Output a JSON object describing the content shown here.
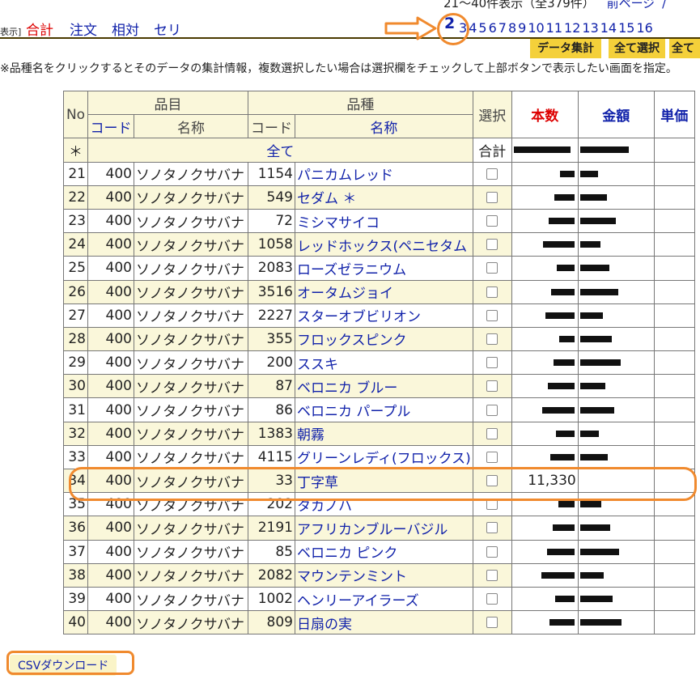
{
  "top": {
    "range_text": "21～40件表示（全379件）",
    "prev_page": "前ページ",
    "edge_glyph": "/"
  },
  "modes": {
    "label": "表示]",
    "items": [
      "合計",
      "注文",
      "相対",
      "セリ"
    ],
    "active_color": "#dd0000",
    "link_color": "#1122aa"
  },
  "pager": {
    "current": "2",
    "pages": [
      "3",
      "4",
      "5",
      "6",
      "7",
      "8",
      "9",
      "10",
      "11",
      "12",
      "13",
      "14",
      "15",
      "16"
    ]
  },
  "buttons": {
    "aggregate": "データ集計",
    "select_all": "全て選択",
    "select_all_2": "全て"
  },
  "instruction": "※品種名をクリックするとそのデータの集計情報，複数選択したい場合は選択欄をチェックして上部ボタンで表示したい画面を指定。",
  "table": {
    "headers": {
      "no": "No",
      "item": "品目",
      "variety": "品種",
      "select": "選択",
      "qty": "本数",
      "amount": "金額",
      "unit": "単価",
      "code": "コード",
      "name": "名称",
      "total_label": "合計",
      "star": "＊",
      "all": "全て"
    },
    "rows": [
      {
        "no": "21",
        "icode": "400",
        "iname": "ソノタノクサバナ",
        "vcode": "1154",
        "vname": "パニカムレッド"
      },
      {
        "no": "22",
        "icode": "400",
        "iname": "ソノタノクサバナ",
        "vcode": "549",
        "vname": "セダム ＊"
      },
      {
        "no": "23",
        "icode": "400",
        "iname": "ソノタノクサバナ",
        "vcode": "72",
        "vname": "ミシマサイコ"
      },
      {
        "no": "24",
        "icode": "400",
        "iname": "ソノタノクサバナ",
        "vcode": "1058",
        "vname": "レッドホックス(ペニセタム"
      },
      {
        "no": "25",
        "icode": "400",
        "iname": "ソノタノクサバナ",
        "vcode": "2083",
        "vname": "ローズゼラニウム"
      },
      {
        "no": "26",
        "icode": "400",
        "iname": "ソノタノクサバナ",
        "vcode": "3516",
        "vname": "オータムジョイ"
      },
      {
        "no": "27",
        "icode": "400",
        "iname": "ソノタノクサバナ",
        "vcode": "2227",
        "vname": "スターオブビリオン"
      },
      {
        "no": "28",
        "icode": "400",
        "iname": "ソノタノクサバナ",
        "vcode": "355",
        "vname": "フロックスピンク"
      },
      {
        "no": "29",
        "icode": "400",
        "iname": "ソノタノクサバナ",
        "vcode": "200",
        "vname": "ススキ"
      },
      {
        "no": "30",
        "icode": "400",
        "iname": "ソノタノクサバナ",
        "vcode": "87",
        "vname": "ベロニカ ブルー"
      },
      {
        "no": "31",
        "icode": "400",
        "iname": "ソノタノクサバナ",
        "vcode": "86",
        "vname": "ベロニカ パープル"
      },
      {
        "no": "32",
        "icode": "400",
        "iname": "ソノタノクサバナ",
        "vcode": "1383",
        "vname": "朝霧"
      },
      {
        "no": "33",
        "icode": "400",
        "iname": "ソノタノクサバナ",
        "vcode": "4115",
        "vname": "グリーンレディ(フロックス)"
      },
      {
        "no": "34",
        "icode": "400",
        "iname": "ソノタノクサバナ",
        "vcode": "33",
        "vname": "丁字草",
        "qty": "11,330"
      },
      {
        "no": "35",
        "icode": "400",
        "iname": "ソノタノクサバナ",
        "vcode": "202",
        "vname": "タカノハ"
      },
      {
        "no": "36",
        "icode": "400",
        "iname": "ソノタノクサバナ",
        "vcode": "2191",
        "vname": "アフリカンブルーバジル"
      },
      {
        "no": "37",
        "icode": "400",
        "iname": "ソノタノクサバナ",
        "vcode": "85",
        "vname": "ベロニカ ピンク"
      },
      {
        "no": "38",
        "icode": "400",
        "iname": "ソノタノクサバナ",
        "vcode": "2082",
        "vname": "マウンテンミント"
      },
      {
        "no": "39",
        "icode": "400",
        "iname": "ソノタノクサバナ",
        "vcode": "1002",
        "vname": "ヘンリーアイラーズ"
      },
      {
        "no": "40",
        "icode": "400",
        "iname": "ソノタノクサバナ",
        "vcode": "809",
        "vname": "日扇の実"
      }
    ]
  },
  "csv_download": "CSVダウンロード",
  "colors": {
    "highlight_orange": "#f08a2e",
    "button_yellow": "#f4d03a",
    "row_tint": "#faf7da",
    "header_red": "#dd0000"
  }
}
